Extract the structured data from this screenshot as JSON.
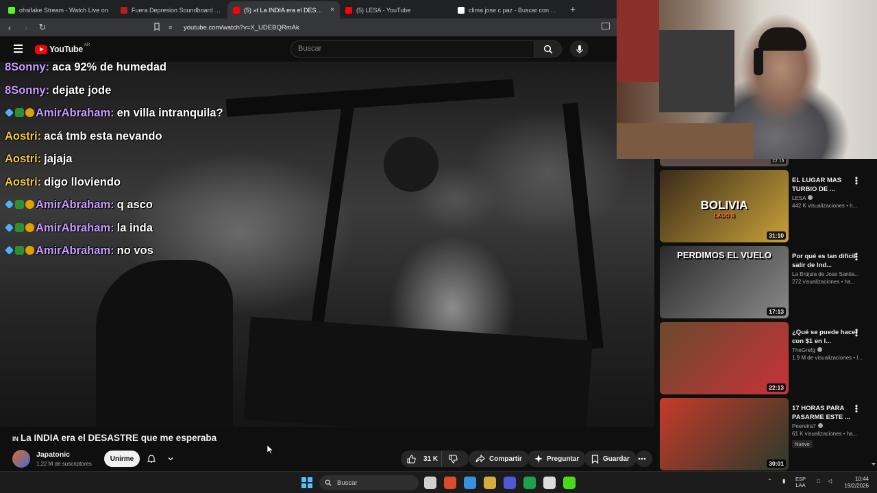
{
  "browser": {
    "tabs": [
      {
        "title": "ohsifake Stream - Watch Live on",
        "color": "#53fc18",
        "active": false
      },
      {
        "title": "Fuera Depresion Soundboard - Boto",
        "color": "#b81f1f",
        "active": false
      },
      {
        "title": "(5) »t La INDIA era el DESASTR",
        "color": "#ff0000",
        "active": true
      },
      {
        "title": "(5) LESA - YouTube",
        "color": "#ff0000",
        "active": false
      },
      {
        "title": "clima jose c paz - Buscar con Google",
        "color": "#ffffff",
        "active": false
      }
    ],
    "new_tab": "+",
    "url": "youtube.com/watch?v=X_UDEBQRmAk"
  },
  "youtube": {
    "logo_text": "YouTube",
    "region": "AR",
    "search_placeholder": "Buscar"
  },
  "chat": [
    {
      "badges": false,
      "user": "8Sonny:",
      "message": "aca 92% de humedad",
      "color": "#c89bff"
    },
    {
      "badges": false,
      "user": "8Sonny:",
      "message": "dejate jode",
      "color": "#c89bff"
    },
    {
      "badges": true,
      "user": "AmirAbraham:",
      "message": "en villa intranquila?",
      "color": "#c89bff"
    },
    {
      "badges": false,
      "user": "Aostri:",
      "message": "acá tmb esta nevando",
      "color": "#f4c842"
    },
    {
      "badges": false,
      "user": "Aostri:",
      "message": "jajaja",
      "color": "#f4c842"
    },
    {
      "badges": false,
      "user": "Aostri:",
      "message": "digo lloviendo",
      "color": "#f4c842"
    },
    {
      "badges": true,
      "user": "AmirAbraham:",
      "message": "q asco",
      "color": "#c89bff"
    },
    {
      "badges": true,
      "user": "AmirAbraham:",
      "message": "la inda",
      "color": "#c89bff"
    },
    {
      "badges": true,
      "user": "AmirAbraham:",
      "message": "no vos",
      "color": "#c89bff"
    }
  ],
  "video": {
    "title_prefix": "IN",
    "title": "La INDIA era el DESASTRE que me esperaba",
    "channel": "Japatonic",
    "subscribers": "1,22 M de suscriptores",
    "join_label": "Unirme",
    "likes": "31 K",
    "share_label": "Compartir",
    "ask_label": "Preguntar",
    "save_label": "Guardar"
  },
  "recommendations": {
    "top_duration": "22:15",
    "items": [
      {
        "title": "EL LUGAR MAS TURBIO DE ...",
        "channel": "LESA",
        "verified": true,
        "views": "442 K visualizaciones • h...",
        "duration": "31:10",
        "thumb_text": "BOLIVIA",
        "thumb_subtext": "LADO B",
        "badge": "",
        "thumb_colors": [
          "#3a2a1a",
          "#c9a23a"
        ]
      },
      {
        "title": "Por qué es tan difícil salir de Ind...",
        "channel": "La Brújula de Jose Santia...",
        "verified": false,
        "views": "272 visualizaciones • ha...",
        "duration": "17:13",
        "thumb_text": "PERDIMOS EL VUELO",
        "thumb_subtext": "",
        "badge": "",
        "thumb_colors": [
          "#2a2a2a",
          "#8a8a8a"
        ]
      },
      {
        "title": "¿Qué se puede hacer con $1 en l...",
        "channel": "TheGrefg",
        "verified": true,
        "views": "1,9 M de visualizaciones • l...",
        "duration": "22:13",
        "thumb_text": "",
        "thumb_subtext": "",
        "badge": "",
        "thumb_colors": [
          "#6a4a2a",
          "#c8323a"
        ]
      },
      {
        "title": "17 HORAS PARA PASARME ESTE ...",
        "channel": "Peereira7",
        "verified": true,
        "views": "61 K visualizaciones • ha...",
        "duration": "30:01",
        "thumb_text": "",
        "thumb_subtext": "",
        "badge": "Nuevo",
        "thumb_colors": [
          "#c83a2a",
          "#2a3a2a"
        ]
      }
    ]
  },
  "taskbar": {
    "search_placeholder": "Buscar",
    "lang_top": "ESP",
    "lang_bottom": "LAA",
    "time": "10:44",
    "date": "19/2/2026",
    "app_colors": [
      "#f0f0f0",
      "#fb542b",
      "#3ea6ff",
      "#f4c542",
      "#5865f2",
      "#1db954",
      "#ffffff",
      "#53fc18"
    ]
  }
}
